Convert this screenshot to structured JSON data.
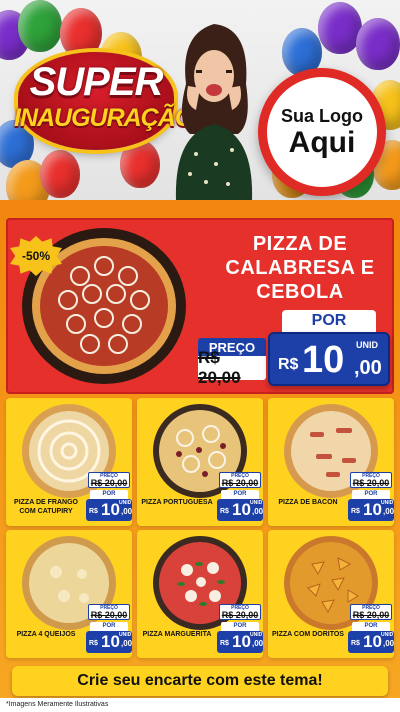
{
  "header": {
    "super": "SUPER",
    "inauguracao": "INAUGURAÇÃO",
    "logo_line1": "Sua Logo",
    "logo_line2": "Aqui"
  },
  "hero": {
    "discount": "-50%",
    "title": "PIZZA DE CALABRESA E CEBOLA",
    "preco_label": "PREÇO",
    "old_price": "R$ 20,00",
    "por_label": "POR",
    "currency": "R$",
    "price_int": "10",
    "price_cents": ",00",
    "unit": "UNID"
  },
  "products": [
    {
      "name": "PIZZA DE FRANGO COM CATUPIRY",
      "preco_label": "PREÇO",
      "old_price": "R$ 20,00",
      "por_label": "POR",
      "currency": "R$",
      "price_int": "10",
      "price_cents": ",00",
      "unit": "UNID"
    },
    {
      "name": "PIZZA PORTUGUESA",
      "preco_label": "PREÇO",
      "old_price": "R$ 20,00",
      "por_label": "POR",
      "currency": "R$",
      "price_int": "10",
      "price_cents": ",00",
      "unit": "UNID"
    },
    {
      "name": "PIZZA DE BACON",
      "preco_label": "PREÇO",
      "old_price": "R$ 20,00",
      "por_label": "POR",
      "currency": "R$",
      "price_int": "10",
      "price_cents": ",00",
      "unit": "UNID"
    },
    {
      "name": "PIZZA 4 QUEIJOS",
      "preco_label": "PREÇO",
      "old_price": "R$ 20,00",
      "por_label": "POR",
      "currency": "R$",
      "price_int": "10",
      "price_cents": ",00",
      "unit": "UNID"
    },
    {
      "name": "PIZZA MARGUERITA",
      "preco_label": "PREÇO",
      "old_price": "R$ 20,00",
      "por_label": "POR",
      "currency": "R$",
      "price_int": "10",
      "price_cents": ",00",
      "unit": "UNID"
    },
    {
      "name": "PIZZA COM DORITOS",
      "preco_label": "PREÇO",
      "old_price": "R$ 20,00",
      "por_label": "POR",
      "currency": "R$",
      "price_int": "10",
      "price_cents": ",00",
      "unit": "UNID"
    }
  ],
  "footer": {
    "cta": "Crie seu encarte com este tema!",
    "disclaimer": "*Imagens Meramente Ilustrativas"
  },
  "colors": {
    "brand_red": "#e6302b",
    "brand_blue": "#1d3fa8",
    "brand_yellow": "#ffd21f",
    "background_orange": "#f2860f"
  },
  "icons": {
    "balloons": "balloon-icon",
    "pizza": "pizza-image"
  }
}
